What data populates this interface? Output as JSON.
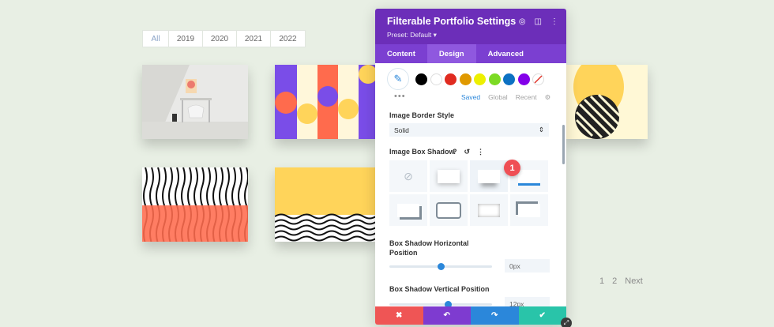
{
  "filters": [
    "All",
    "2019",
    "2020",
    "2021",
    "2022"
  ],
  "pagination": [
    "1",
    "2",
    "Next"
  ],
  "panel": {
    "title": "Filterable Portfolio Settings",
    "preset": "Preset: Default ▾",
    "header_icons": [
      "target-icon",
      "sidebar-icon",
      "more-icon"
    ],
    "tabs": [
      "Content",
      "Design",
      "Advanced"
    ],
    "active_tab": "Design",
    "swatch_colors": [
      "#000000",
      "#ffffff",
      "#e02b20",
      "#e09900",
      "#edf000",
      "#7cda24",
      "#0c71c3",
      "#8300e9"
    ],
    "saved_tabs": [
      "Saved",
      "Global",
      "Recent"
    ],
    "border_style_label": "Image Border Style",
    "border_style_value": "Solid",
    "box_shadow_label": "Image Box Shadow",
    "badge": "1",
    "h_label": "Box Shadow Horizontal Position",
    "h_value": "0px",
    "h_level": 0.5,
    "v_label": "Box Shadow Vertical Position",
    "v_value": "12px",
    "v_level": 0.57
  },
  "colors": {
    "purple": "#6c2eb9",
    "tab_purple": "#7b3fd1",
    "cancel": "#ef5555",
    "undo": "#7e3bd0",
    "redo": "#2b87da",
    "save": "#29c4a9"
  }
}
